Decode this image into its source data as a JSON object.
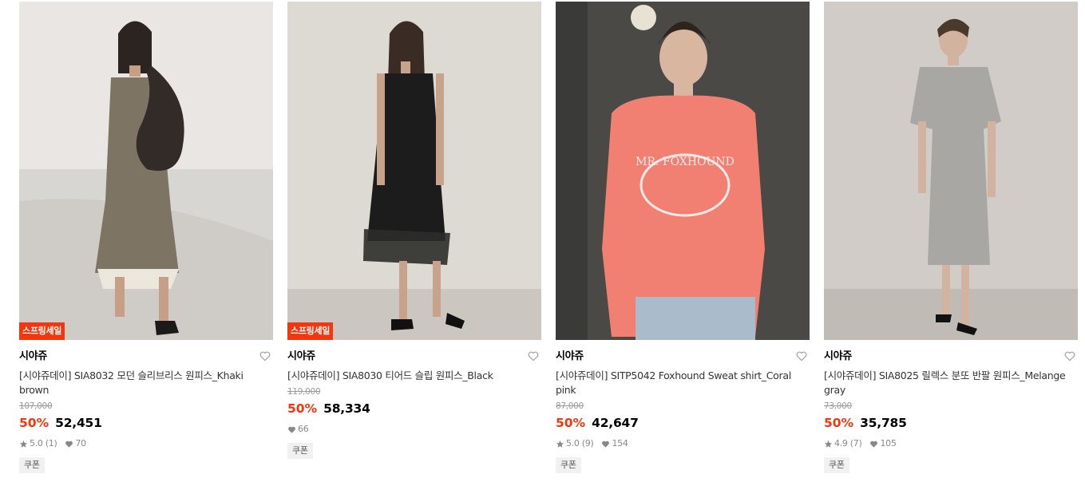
{
  "products": [
    {
      "badge": "스프링세일",
      "brand": "시야쥬",
      "name": "[시야쥬데이] SIA8032 모던 슬리브리스 원피스_Khaki brown",
      "original_price": "107,000",
      "discount": "50%",
      "price": "52,451",
      "rating": "5.0 (1)",
      "likes": "70",
      "coupon": "쿠폰",
      "image_desc": "model in khaki sleeveless dress with black shoulder bag"
    },
    {
      "badge": "스프링세일",
      "brand": "시야쥬",
      "name": "[시야쥬데이] SIA8030 티어드 슬립 원피스_Black",
      "original_price": "119,000",
      "discount": "50%",
      "price": "58,334",
      "rating": "",
      "likes": "66",
      "coupon": "쿠폰",
      "image_desc": "model in black tiered slip dress"
    },
    {
      "badge": "",
      "brand": "시야쥬",
      "name": "[시야쥬데이] SITP5042 Foxhound Sweat shirt_Coral pink",
      "original_price": "87,000",
      "discount": "50%",
      "price": "42,647",
      "rating": "5.0 (9)",
      "likes": "154",
      "coupon": "쿠폰",
      "image_desc": "model in coral pink sweatshirt with MR. FOXHOUND print"
    },
    {
      "badge": "",
      "brand": "시야쥬",
      "name": "[시야쥬데이] SIA8025 릴렉스 분또 반팔 원피스_Melange gray",
      "original_price": "73,000",
      "discount": "50%",
      "price": "35,785",
      "rating": "4.9 (7)",
      "likes": "105",
      "coupon": "쿠폰",
      "image_desc": "model in melange gray short-sleeve dress"
    }
  ],
  "colors": {
    "accent": "#f2360d",
    "muted": "#999999",
    "coupon_bg": "#f1f1f1"
  },
  "icons": {
    "heart": "heart-outline-icon",
    "star": "star-icon",
    "like": "heart-filled-icon"
  }
}
